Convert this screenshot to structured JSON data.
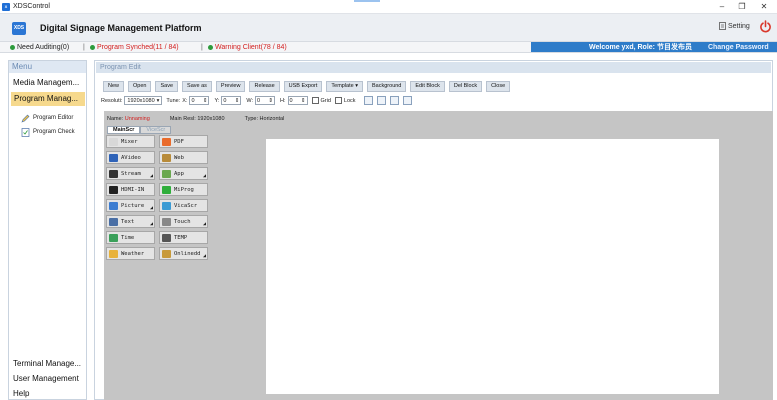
{
  "window": {
    "title": "XDSControl",
    "minimize": "–",
    "maximize": "❐",
    "close": "✕"
  },
  "header": {
    "logo_text": "XDS",
    "platform_title": "Digital Signage Management Platform",
    "setting_label": "Setting"
  },
  "status": {
    "need_auditing": "Need Auditing(0)",
    "program_synched": "Program Synched(11 / 84)",
    "warning_client": "Warning Client(78 / 84)",
    "separator": "|",
    "welcome": "Welcome yxd, Role: 节目发布员",
    "change_password": "Change Password",
    "colors": {
      "ok": "#2d9b3c",
      "warn": "#d32020",
      "accent": "#2e7cc9"
    }
  },
  "sidebar": {
    "menu_label": "Menu",
    "items": [
      {
        "label": "Media Managem..."
      },
      {
        "label": "Program Manag..."
      }
    ],
    "sub_items": [
      {
        "label": "Program Editor",
        "icon": "pencil-icon"
      },
      {
        "label": "Program Check",
        "icon": "check-list-icon"
      }
    ],
    "bottom_items": [
      {
        "label": "Terminal Manage..."
      },
      {
        "label": "User Management"
      },
      {
        "label": "Help"
      }
    ]
  },
  "panel": {
    "title": "Program Edit",
    "toolbar": [
      "New",
      "Open",
      "Save",
      "Save as",
      "Preview",
      "Release",
      "USB Export",
      "Template",
      "Background",
      "Edit Block",
      "Del Block",
      "Close"
    ],
    "template_arrow": "▾",
    "resolution_label": "Resoluti:",
    "resolution_value": "1920x1080",
    "tune_label": "Tune:",
    "x_label": "X:",
    "x_value": "0",
    "y_label": "Y:",
    "y_value": "0",
    "w_label": "W:",
    "w_value": "0",
    "h_label": "H:",
    "h_value": "0",
    "grid_label": "Grid",
    "lock_label": "Lock"
  },
  "editor": {
    "name_label": "Name:",
    "name_value": "Unnaming",
    "main_res_label": "Main Resl:",
    "main_res_value": "1920x1080",
    "type_label": "Type:",
    "type_value": "Horizontal",
    "tabs": [
      "MainScr",
      "ViceScr"
    ],
    "tools": [
      {
        "label": "Mixer",
        "icon": "mixer-icon",
        "color": "#d8d8d8",
        "more": false
      },
      {
        "label": "PDF",
        "icon": "pdf-icon",
        "color": "#e96b2b",
        "more": false
      },
      {
        "label": "AVideo",
        "icon": "video-icon",
        "color": "#2f63b8",
        "more": false
      },
      {
        "label": "Web",
        "icon": "web-icon",
        "color": "#b88b3a",
        "more": false
      },
      {
        "label": "Stream",
        "icon": "stream-icon",
        "color": "#333333",
        "more": true
      },
      {
        "label": "App",
        "icon": "app-icon",
        "color": "#6aa84f",
        "more": true
      },
      {
        "label": "HDMI-IN",
        "icon": "hdmi-icon",
        "color": "#222222",
        "more": false
      },
      {
        "label": "MiProg",
        "icon": "wechat-icon",
        "color": "#2fae3b",
        "more": false
      },
      {
        "label": "Picture",
        "icon": "picture-icon",
        "color": "#3d7dd1",
        "more": true
      },
      {
        "label": "VicaScr",
        "icon": "vicescreen-icon",
        "color": "#3b9bd4",
        "more": false
      },
      {
        "label": "Text",
        "icon": "text-icon",
        "color": "#4a6fa5",
        "more": true
      },
      {
        "label": "Touch",
        "icon": "touch-icon",
        "color": "#888888",
        "more": true
      },
      {
        "label": "Time",
        "icon": "clock-icon",
        "color": "#3aa05a",
        "more": false
      },
      {
        "label": "TEMP",
        "icon": "thermometer-icon",
        "color": "#555555",
        "more": false
      },
      {
        "label": "Weather",
        "icon": "weather-icon",
        "color": "#e8b23a",
        "more": false
      },
      {
        "label": "Onlinedd",
        "icon": "online-icon",
        "color": "#c89a3a",
        "more": true
      }
    ],
    "more_glyph": "◢"
  }
}
